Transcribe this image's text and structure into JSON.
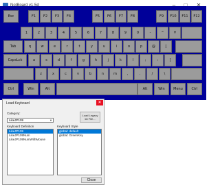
{
  "window": {
    "title": "NotBoard v1.5d",
    "minimize": "–",
    "maximize": "□",
    "close": "✕"
  },
  "keyboard": {
    "row0": [
      {
        "label": "Esc",
        "l": 5,
        "w": 22
      },
      {
        "label": "F1",
        "l": 41,
        "w": 16
      },
      {
        "label": "F2",
        "l": 58,
        "w": 16
      },
      {
        "label": "F3",
        "l": 75,
        "w": 16
      },
      {
        "label": "F4",
        "l": 92,
        "w": 16
      },
      {
        "label": "F5",
        "l": 134,
        "w": 16
      },
      {
        "label": "F6",
        "l": 151,
        "w": 16
      },
      {
        "label": "F7",
        "l": 168,
        "w": 16
      },
      {
        "label": "F8",
        "l": 185,
        "w": 16
      },
      {
        "label": "F9",
        "l": 227,
        "w": 16
      },
      {
        "label": "F10",
        "l": 244,
        "w": 16
      },
      {
        "label": "F11",
        "l": 261,
        "w": 16
      },
      {
        "label": "F12",
        "l": 278,
        "w": 16
      }
    ],
    "row1": [
      "1",
      "2",
      "3",
      "4",
      "5",
      "6",
      "7",
      "8",
      "9",
      "0",
      "-",
      "^",
      "¥"
    ],
    "row2_tab": "Tab",
    "row2": [
      "q",
      "w",
      "e",
      "r",
      "t",
      "y",
      "u",
      "i",
      "o",
      "p",
      "@",
      "["
    ],
    "row3_caps": "CapsLck",
    "row3": [
      "a",
      "s",
      "d",
      "f",
      "g",
      "h",
      "j",
      "k",
      "l",
      ";",
      ":",
      "]"
    ],
    "row4": [
      "z",
      "x",
      "c",
      "v",
      "b",
      "n",
      "m",
      ",",
      ".",
      "/",
      "\\"
    ],
    "row5": [
      {
        "label": "Ctrl",
        "l": 5,
        "w": 22
      },
      {
        "label": "Win",
        "l": 34,
        "w": 22
      },
      {
        "label": "Alt",
        "l": 58,
        "w": 22
      },
      {
        "label": "",
        "l": 82,
        "w": 118
      },
      {
        "label": "Alt",
        "l": 200,
        "w": 22
      },
      {
        "label": "Win",
        "l": 224,
        "w": 22
      },
      {
        "label": "Menu",
        "l": 248,
        "w": 22
      },
      {
        "label": "Ctrl",
        "l": 272,
        "w": 22
      }
    ]
  },
  "dialog": {
    "title": "Load Keyboard",
    "close": "✕",
    "category_label": "Category:",
    "category_value": "LikeJP109",
    "load_legacy_line1": "Load Legacy",
    "load_legacy_line2": "kb File...",
    "definition_label": "Keyboard Definition",
    "definitions": [
      "LikeJP109",
      "LikeJP109Num",
      "LikeJP109NumWithMouse"
    ],
    "style_label": "Keyboard Style",
    "styles": [
      "global: default",
      "global: GreenKey"
    ],
    "close_button": "Close"
  }
}
